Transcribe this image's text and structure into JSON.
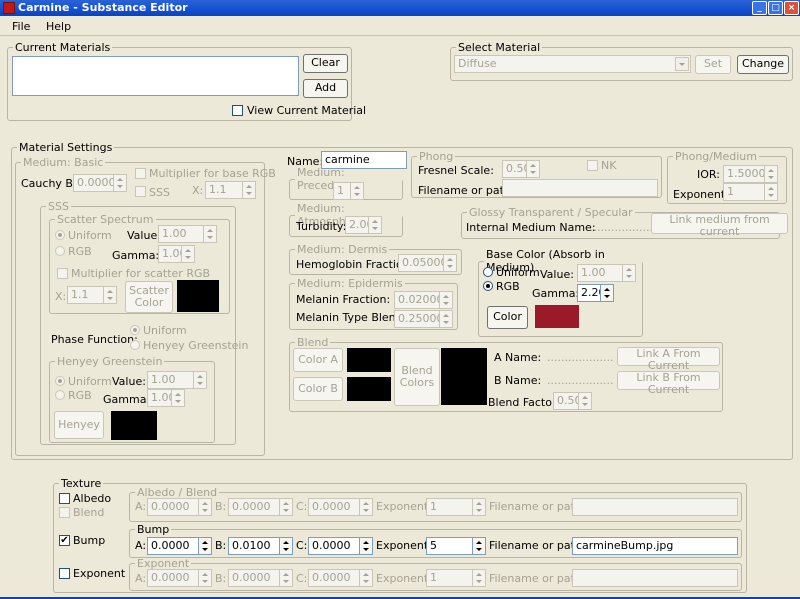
{
  "window": {
    "title": "Carmine - Substance Editor",
    "min": "_",
    "max": "□",
    "close": "×"
  },
  "menu": {
    "file": "File",
    "help": "Help"
  },
  "current": {
    "legend": "Current Materials",
    "clear": "Clear",
    "add": "Add",
    "view": "View Current Material"
  },
  "select": {
    "legend": "Select Material",
    "value": "Diffuse",
    "set": "Set",
    "change": "Change"
  },
  "settings": {
    "legend": "Material Settings"
  },
  "basic": {
    "legend": "Medium: Basic",
    "cauchy_label": "Cauchy B:",
    "cauchy": "0.00000",
    "mult_base": "Multiplier for base RGB",
    "sss": "SSS",
    "x_label": "X:",
    "x": "1.1"
  },
  "sssbox": {
    "legend": "SSS"
  },
  "scatter": {
    "legend": "Scatter Spectrum",
    "uniform": "Uniform",
    "rgb": "RGB",
    "value_label": "Value:",
    "value": "1.00",
    "gamma_label": "Gamma:",
    "gamma": "1.00",
    "mult": "Multiplier for scatter RGB",
    "x_label": "X:",
    "x": "1.1",
    "button": "Scatter Color"
  },
  "phase": {
    "label": "Phase Function:",
    "uniform": "Uniform",
    "henyey": "Henyey Greenstein"
  },
  "henyey": {
    "legend": "Henyey Greenstein",
    "uniform": "Uniform",
    "rgb": "RGB",
    "value_label": "Value:",
    "value": "1.00",
    "gamma_label": "Gamma:",
    "gamma": "1.00",
    "button": "Henyey"
  },
  "name": {
    "label": "Name:",
    "value": "carmine"
  },
  "precedence": {
    "legend": "Medium: Precedence",
    "value": "1"
  },
  "atmosphere": {
    "legend": "Medium: Atmosphere",
    "label": "Turbidity:",
    "value": "2.00"
  },
  "dermis": {
    "legend": "Medium: Dermis",
    "label": "Hemoglobin Fraction:",
    "value": "0.050000"
  },
  "epidermis": {
    "legend": "Medium: Epidermis",
    "melanin_label": "Melanin Fraction:",
    "melanin": "0.020000",
    "blend_label": "Melanin Type Blend:",
    "blend": "0.250000"
  },
  "phong": {
    "legend": "Phong",
    "fresnel_label": "Fresnel Scale:",
    "fresnel": "0.50",
    "nk": "NK",
    "file_label": "Filename or path:"
  },
  "phongmedium": {
    "legend": "Phong/Medium",
    "ior_label": "IOR:",
    "ior": "1.50000",
    "exp_label": "Exponent:",
    "exp": "1"
  },
  "glossy": {
    "legend": "Glossy Transparent / Specular",
    "internal_label": "Internal Medium Name:",
    "dots": "...................",
    "link": "Link medium from current"
  },
  "basecolor": {
    "legend": "Base Color (Absorb in Medium)",
    "uniform": "Uniform",
    "rgb": "RGB",
    "value_label": "Value:",
    "value": "1.00",
    "gamma_label": "Gamma:",
    "gamma": "2.20",
    "button": "Color",
    "swatch": "#9b1a2a"
  },
  "blend": {
    "legend": "Blend",
    "color_a": "Color A",
    "color_b": "Color B",
    "blend_colors": "Blend Colors",
    "a_name": "A Name:",
    "b_name": "B Name:",
    "dots": "...................",
    "link_a": "Link A From Current",
    "link_b": "Link B From Current",
    "factor_label": "Blend Factor:",
    "factor": "0.50"
  },
  "texture": {
    "legend": "Texture",
    "albedo": "Albedo",
    "blend": "Blend",
    "bump": "Bump",
    "exponent": "Exponent",
    "albedo_legend": "Albedo / Blend",
    "bump_legend": "Bump",
    "exponent_legend": "Exponent",
    "a": "A:",
    "b": "B:",
    "c": "C:",
    "exp_label": "Exponent:",
    "file_label": "Filename or path:",
    "albedo_row": {
      "a": "0.0000",
      "b": "0.0000",
      "c": "0.0000",
      "exp": "1",
      "file": ""
    },
    "bump_row": {
      "a": "0.0000",
      "b": "0.0100",
      "c": "0.0000",
      "exp": "5",
      "file": "carmineBump.jpg"
    },
    "exp_row": {
      "a": "0.0000",
      "b": "0.0000",
      "c": "0.0000",
      "exp": "1",
      "file": ""
    }
  }
}
